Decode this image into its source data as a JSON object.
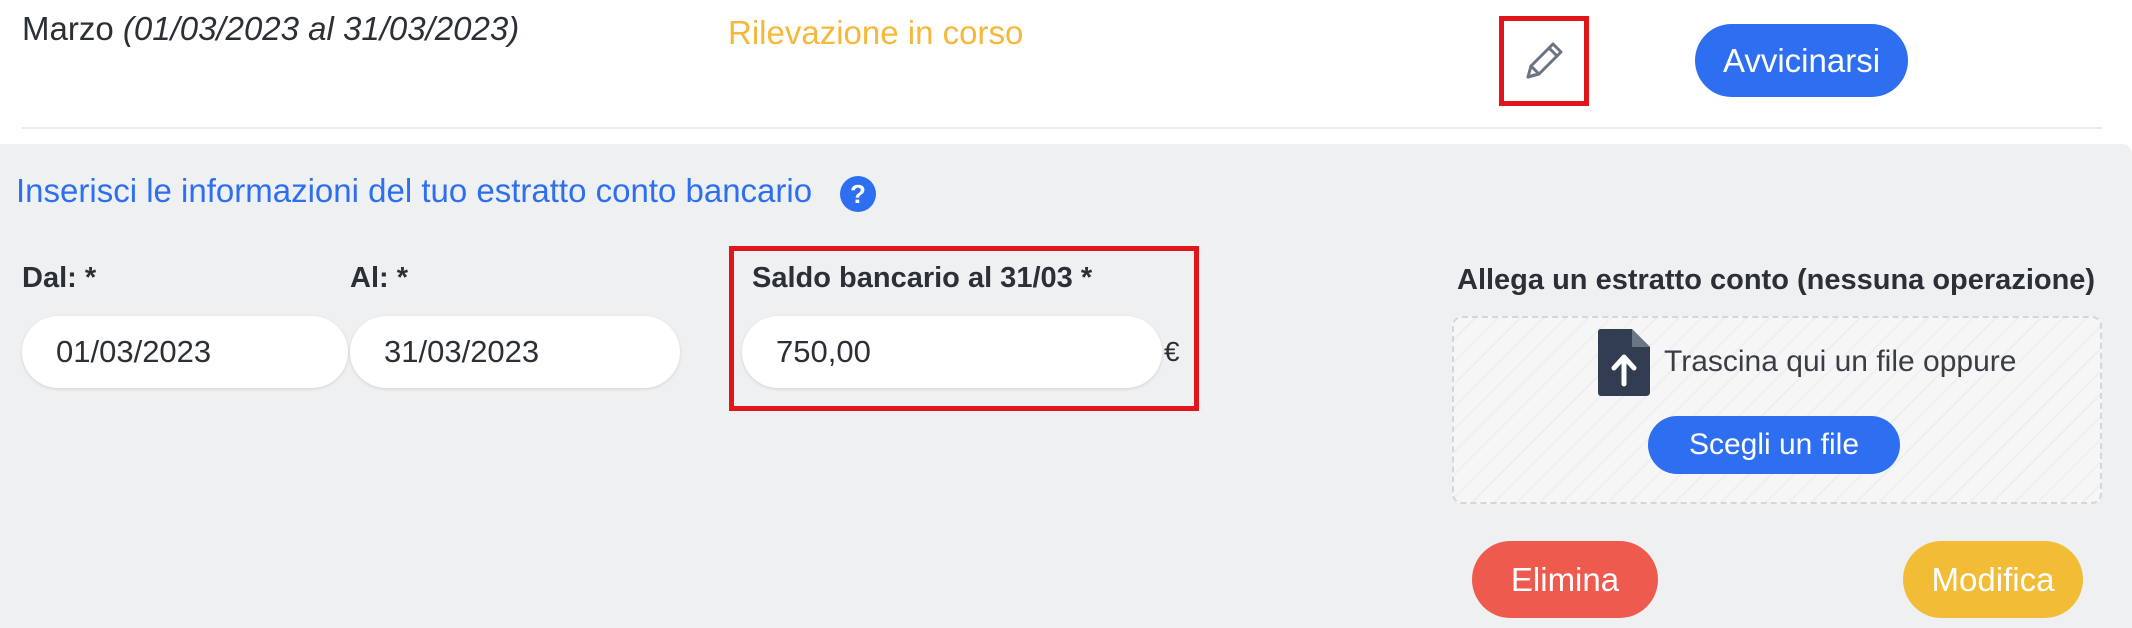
{
  "header": {
    "month": "Marzo",
    "date_range": "(01/03/2023 al 31/03/2023)",
    "status": "Rilevazione in corso",
    "edit_icon": "pencil-icon",
    "close_button": "Avvicinarsi"
  },
  "form": {
    "title": "Inserisci le informazioni del tuo estratto conto bancario",
    "help_icon": "?",
    "from_label": "Dal: *",
    "from_value": "01/03/2023",
    "to_label": "Al: *",
    "to_value": "31/03/2023",
    "balance_label": "Saldo bancario al 31/03 *",
    "balance_value": "750,00",
    "currency": "€"
  },
  "attachment": {
    "label": "Allega un estratto conto (nessuna operazione)",
    "drop_text": "Trascina qui un file oppure",
    "choose_button": "Scegli un file",
    "icon": "file-upload-icon"
  },
  "actions": {
    "delete": "Elimina",
    "edit": "Modifica"
  },
  "colors": {
    "primary": "#2d6ff0",
    "status": "#f5b83a",
    "delete": "#ef5a4f",
    "edit": "#f2bc36",
    "highlight": "#e0161b",
    "panel": "#eff0f2"
  }
}
